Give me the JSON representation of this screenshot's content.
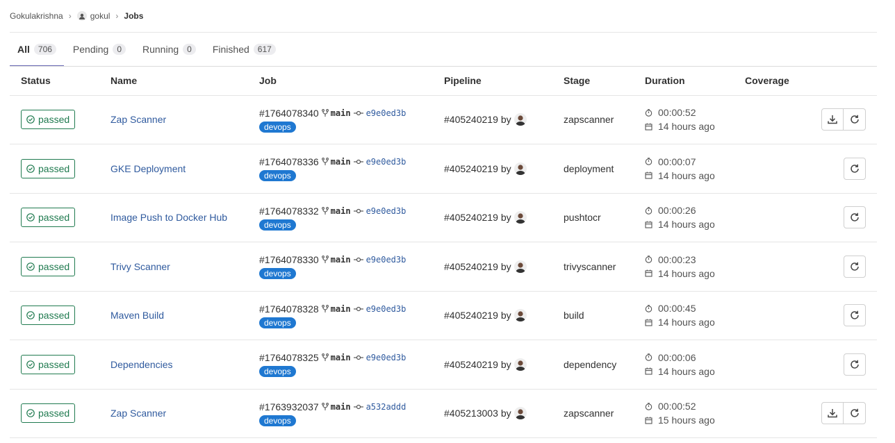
{
  "breadcrumb": {
    "items": [
      "Gokulakrishna",
      "gokul",
      "Jobs"
    ]
  },
  "tabs": [
    {
      "label": "All",
      "count": "706"
    },
    {
      "label": "Pending",
      "count": "0"
    },
    {
      "label": "Running",
      "count": "0"
    },
    {
      "label": "Finished",
      "count": "617"
    }
  ],
  "columns": [
    "Status",
    "Name",
    "Job",
    "Pipeline",
    "Stage",
    "Duration",
    "Coverage"
  ],
  "jobs": [
    {
      "status": "passed",
      "name": "Zap Scanner",
      "id": "#1764078340",
      "branch": "main",
      "sha": "e9e0ed3b",
      "tag": "devops",
      "pipeline": "#405240219",
      "by": "by",
      "stage": "zapscanner",
      "duration": "00:00:52",
      "finished": "14 hours ago",
      "has_download": true
    },
    {
      "status": "passed",
      "name": "GKE Deployment",
      "id": "#1764078336",
      "branch": "main",
      "sha": "e9e0ed3b",
      "tag": "devops",
      "pipeline": "#405240219",
      "by": "by",
      "stage": "deployment",
      "duration": "00:00:07",
      "finished": "14 hours ago",
      "has_download": false
    },
    {
      "status": "passed",
      "name": "Image Push to Docker Hub",
      "id": "#1764078332",
      "branch": "main",
      "sha": "e9e0ed3b",
      "tag": "devops",
      "pipeline": "#405240219",
      "by": "by",
      "stage": "pushtocr",
      "duration": "00:00:26",
      "finished": "14 hours ago",
      "has_download": false
    },
    {
      "status": "passed",
      "name": "Trivy Scanner",
      "id": "#1764078330",
      "branch": "main",
      "sha": "e9e0ed3b",
      "tag": "devops",
      "pipeline": "#405240219",
      "by": "by",
      "stage": "trivyscanner",
      "duration": "00:00:23",
      "finished": "14 hours ago",
      "has_download": false
    },
    {
      "status": "passed",
      "name": "Maven Build",
      "id": "#1764078328",
      "branch": "main",
      "sha": "e9e0ed3b",
      "tag": "devops",
      "pipeline": "#405240219",
      "by": "by",
      "stage": "build",
      "duration": "00:00:45",
      "finished": "14 hours ago",
      "has_download": false
    },
    {
      "status": "passed",
      "name": "Dependencies",
      "id": "#1764078325",
      "branch": "main",
      "sha": "e9e0ed3b",
      "tag": "devops",
      "pipeline": "#405240219",
      "by": "by",
      "stage": "dependency",
      "duration": "00:00:06",
      "finished": "14 hours ago",
      "has_download": false
    },
    {
      "status": "passed",
      "name": "Zap Scanner",
      "id": "#1763932037",
      "branch": "main",
      "sha": "a532addd",
      "tag": "devops",
      "pipeline": "#405213003",
      "by": "by",
      "stage": "zapscanner",
      "duration": "00:00:52",
      "finished": "15 hours ago",
      "has_download": true
    }
  ],
  "icons": {
    "status": "check-circle-icon",
    "branch": "branch-icon",
    "commit": "commit-icon",
    "timer": "timer-icon",
    "calendar": "calendar-icon",
    "download": "download-icon",
    "retry": "retry-icon"
  },
  "colors": {
    "passed": "#1f7a4f",
    "link": "#2f5a9e",
    "tag": "#1f78d1",
    "active_tab": "#6b6bb5"
  }
}
